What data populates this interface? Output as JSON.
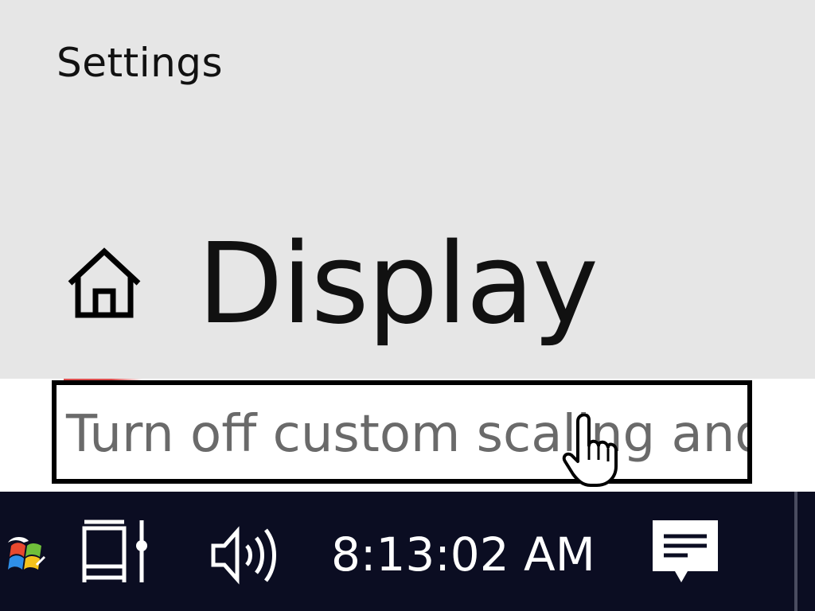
{
  "window": {
    "app_title": "Settings",
    "page_title": "Display"
  },
  "content": {
    "scaling_link_text": "Turn off custom scaling and"
  },
  "taskbar": {
    "clock": "8:13:02 AM",
    "icons": {
      "home": "home-icon",
      "app": "windows-flag-icon",
      "network": "network-icon",
      "volume": "volume-icon",
      "action_center": "action-center-icon",
      "cursor": "hand-pointer-cursor"
    }
  },
  "colors": {
    "header_bg": "#e6e6e6",
    "content_bg": "#ffffff",
    "taskbar_bg": "#0b0d22",
    "link_text": "#6a6a6a",
    "focus_border": "#000000",
    "taskbar_text": "#ffffff"
  }
}
